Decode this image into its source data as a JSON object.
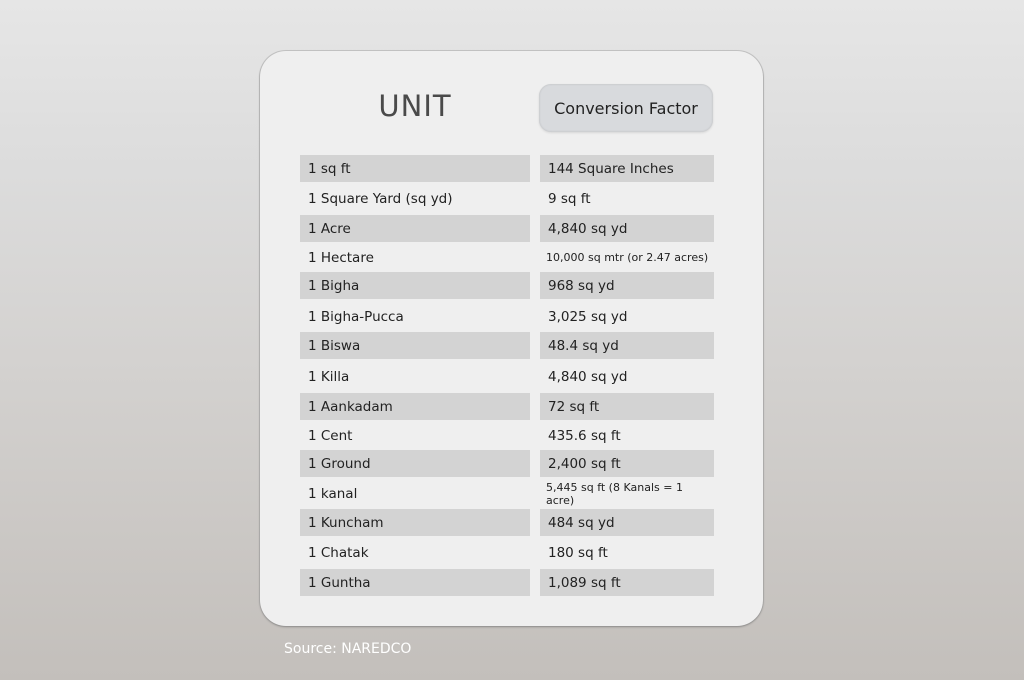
{
  "table": {
    "headers": {
      "unit": "UNIT",
      "conversion": "Conversion Factor"
    },
    "rows": [
      {
        "unit": "1 sq ft",
        "conversion": "144 Square Inches"
      },
      {
        "unit": "1 Square Yard (sq yd)",
        "conversion": "9 sq ft"
      },
      {
        "unit": "1 Acre",
        "conversion": "4,840 sq yd"
      },
      {
        "unit": "1 Hectare",
        "conversion": "10,000 sq mtr (or 2.47 acres)"
      },
      {
        "unit": "1 Bigha",
        "conversion": "968 sq yd"
      },
      {
        "unit": "1 Bigha-Pucca",
        "conversion": "3,025 sq yd"
      },
      {
        "unit": "1 Biswa",
        "conversion": "48.4 sq yd"
      },
      {
        "unit": "1 Killa",
        "conversion": "4,840 sq yd"
      },
      {
        "unit": "1 Aankadam",
        "conversion": "72 sq ft"
      },
      {
        "unit": "1 Cent",
        "conversion": "435.6 sq ft"
      },
      {
        "unit": "1 Ground",
        "conversion": "2,400 sq ft"
      },
      {
        "unit": "1 kanal",
        "conversion": "5,445 sq ft (8 Kanals = 1 acre)"
      },
      {
        "unit": "1 Kuncham",
        "conversion": "484 sq yd"
      },
      {
        "unit": "1 Chatak",
        "conversion": "180 sq ft"
      },
      {
        "unit": "1 Guntha",
        "conversion": "1,089 sq ft"
      }
    ]
  },
  "source": "Source: NAREDCO"
}
